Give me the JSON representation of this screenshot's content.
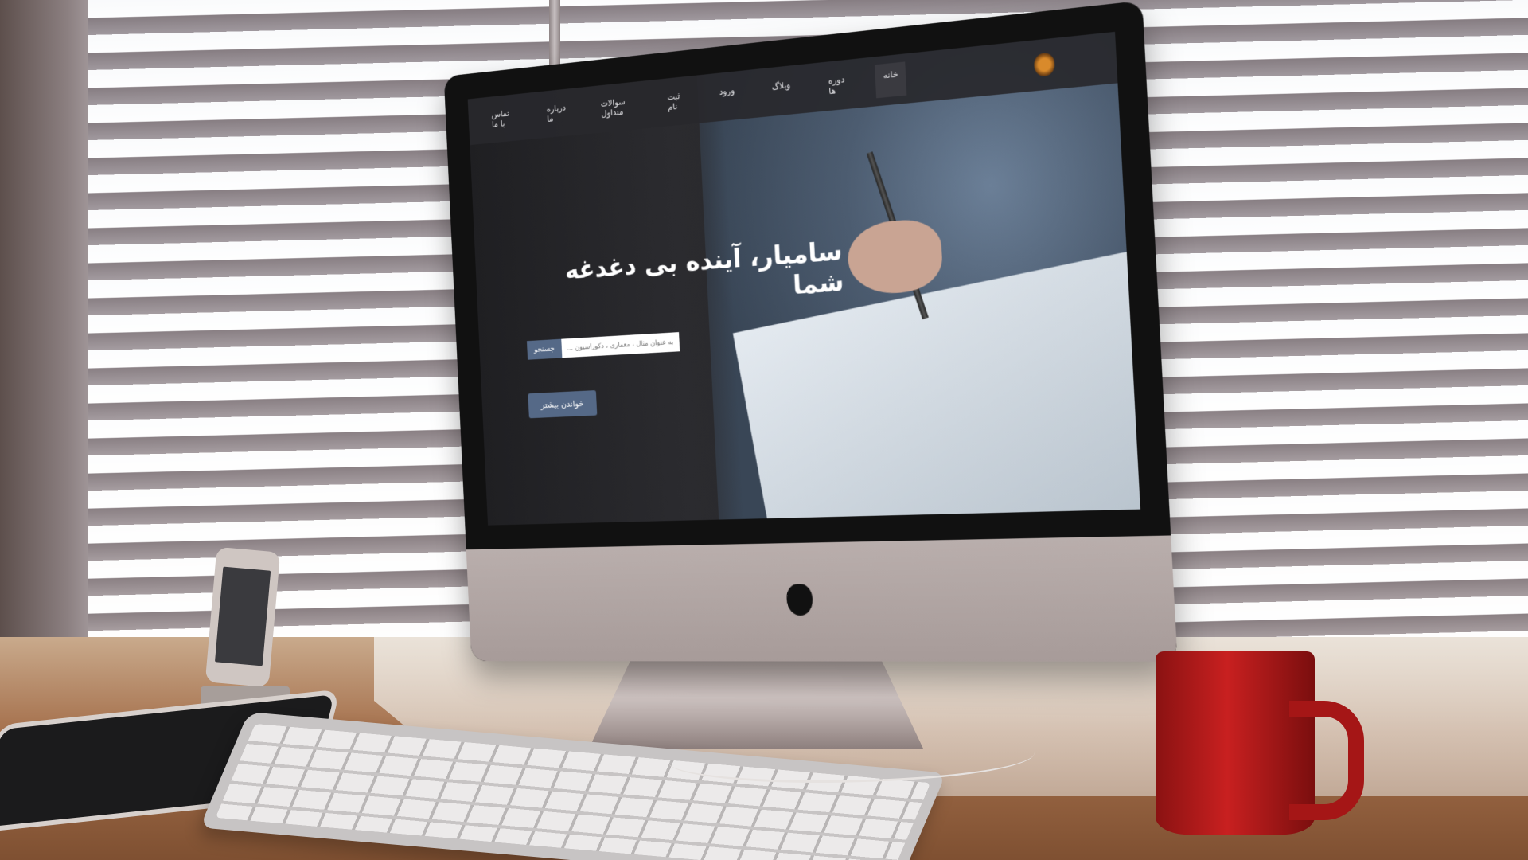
{
  "scene": {
    "description_objects": [
      "imac",
      "window-blinds",
      "iphone",
      "ipad",
      "keyboard",
      "red-mug",
      "desk"
    ]
  },
  "website": {
    "nav": {
      "items": [
        {
          "label": "خانه",
          "active": true
        },
        {
          "label": "دوره ها",
          "active": false
        },
        {
          "label": "وبلاگ",
          "active": false
        },
        {
          "label": "ورود",
          "active": false
        },
        {
          "label": "ثبت نام",
          "active": false
        },
        {
          "label": "سوالات متداول",
          "active": false
        },
        {
          "label": "درباره ما",
          "active": false
        },
        {
          "label": "تماس با ما",
          "active": false
        }
      ]
    },
    "hero": {
      "title": "سامیار، آینده بی دغدغه شما",
      "search_placeholder": "به عنوان مثال ، معماری ، دکوراسیون ...",
      "search_button": "جستجو",
      "cta_button": "خواندن بیشتر"
    }
  },
  "colors": {
    "accent": "#556987",
    "mug": "#c82020"
  }
}
